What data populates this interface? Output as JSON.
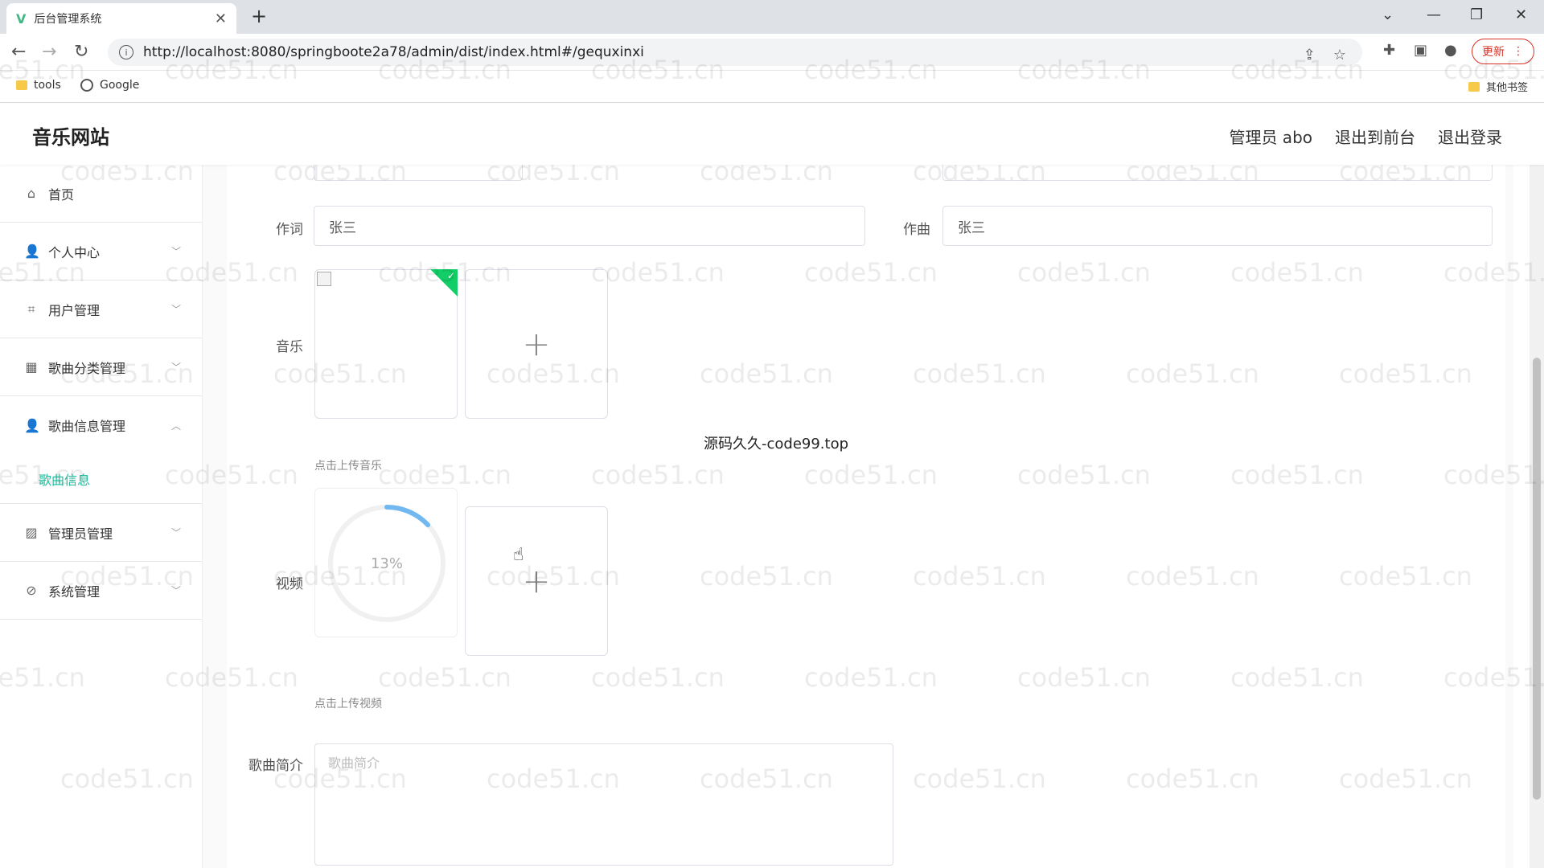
{
  "browser": {
    "tab_title": "后台管理系统",
    "url": "http://localhost:8080/springboote2a78/admin/dist/index.html#/gequxinxi",
    "update_label": "更新",
    "bookmarks": [
      {
        "label": "tools"
      },
      {
        "label": "Google"
      }
    ],
    "other_bookmarks": "其他书签"
  },
  "header": {
    "title": "音乐网站",
    "admin_label": "管理员 abo",
    "front_link": "退出到前台",
    "logout_link": "退出登录"
  },
  "sidebar": {
    "items": [
      {
        "label": "首页",
        "icon": "home-icon"
      },
      {
        "label": "个人中心",
        "icon": "user-icon"
      },
      {
        "label": "用户管理",
        "icon": "crop-icon"
      },
      {
        "label": "歌曲分类管理",
        "icon": "grid-icon"
      },
      {
        "label": "歌曲信息管理",
        "icon": "user-icon"
      },
      {
        "label": "管理员管理",
        "icon": "chart-icon"
      },
      {
        "label": "系统管理",
        "icon": "bell-off-icon"
      }
    ],
    "submenu_active": "歌曲信息"
  },
  "form": {
    "lyricist_label": "作词",
    "lyricist_value": "张三",
    "composer_label": "作曲",
    "composer_value": "张三",
    "music_label": "音乐",
    "music_tip": "点击上传音乐",
    "video_label": "视频",
    "video_tip": "点击上传视频",
    "video_progress": "13%",
    "video_progress_fraction": 0.13,
    "intro_label": "歌曲简介",
    "intro_placeholder": "歌曲简介"
  },
  "overlay_text": "源码久久-code99.top",
  "watermark": "code51.cn"
}
